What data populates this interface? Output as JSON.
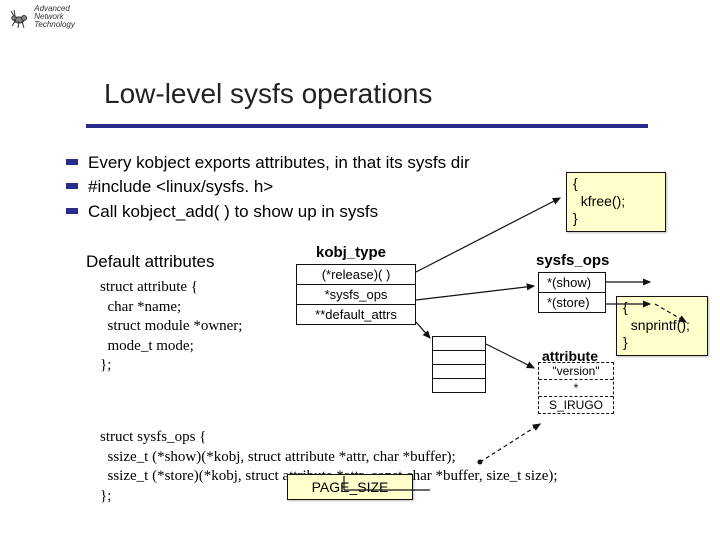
{
  "logo": {
    "line1": "Advanced",
    "line2": "Network",
    "line3": "Technology"
  },
  "title": "Low-level sysfs operations",
  "bullets": [
    "Every kobject exports attributes, in that its sysfs dir",
    "#include <linux/sysfs. h>",
    "Call kobject_add( ) to show up in sysfs"
  ],
  "yb1": {
    "l1": "{",
    "l2": "  kfree();",
    "l3": "}"
  },
  "yb2": {
    "l1": "{",
    "l2": "  snprintf();",
    "l3": "}"
  },
  "yb3": "PAGE_SIZE",
  "sh1": "Default attributes",
  "sh2": "kobj_type",
  "sh3": "sysfs_ops",
  "kobj_rows": [
    "(*release)( )",
    "*sysfs_ops",
    "**default_attrs"
  ],
  "sysops_rows": [
    "*(show)",
    "*(store)"
  ],
  "attr_label": "attribute",
  "attr_rows": [
    "\"version\"",
    "*",
    "S_IRUGO"
  ],
  "struct1": {
    "l1": "struct attribute {",
    "l2": "  char *name;",
    "l3": "  struct module *owner;",
    "l4": "  mode_t mode;",
    "l5": "};"
  },
  "struct2": {
    "l1": "struct sysfs_ops {",
    "l2": "  ssize_t (*show)(*kobj, struct attribute *attr, char *buffer);",
    "l3": "  ssize_t (*store)(*kobj, struct attribute *attr, const char *buffer, size_t size);",
    "l4": "};"
  }
}
